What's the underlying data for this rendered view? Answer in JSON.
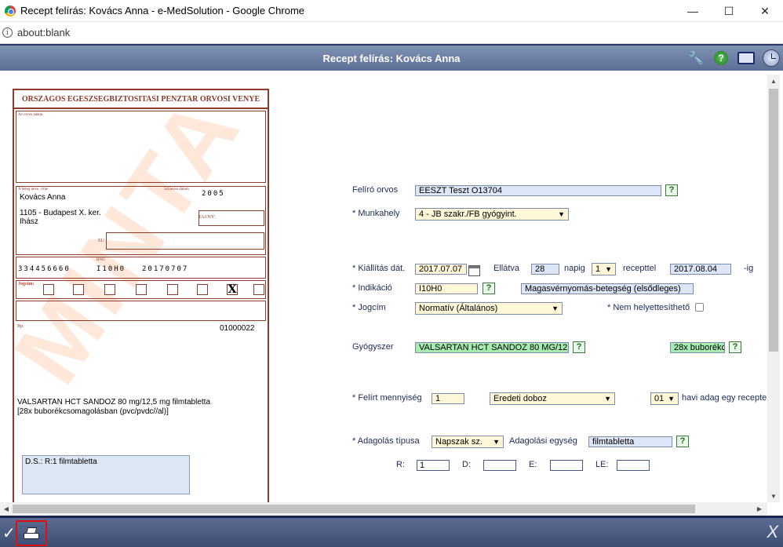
{
  "window": {
    "title": "Recept felírás: Kovács Anna - e-MedSolution - Google Chrome"
  },
  "address": {
    "url": "about:blank"
  },
  "app": {
    "title": "Recept felírás: Kovács Anna"
  },
  "prescription_form": {
    "header": "ORSZAGOS EGESZSEGBIZTOSITASI PENZTAR ORVOSI VENYE",
    "doctor_label": "Az orvos adatai",
    "patient_label": "A beteg neve, címe",
    "birth_label": "Születési dátum",
    "birth_year": "2005",
    "patient_name": "Kovács Anna",
    "patient_address_line1": "1105 - Budapest X. ker.",
    "patient_address_line2": "Ihász",
    "taj_label": "TAJ/NY:",
    "eu_label": "EU",
    "taj_number": "334456660",
    "bno_label": "BNO",
    "bno_code": "I10H0",
    "date_digits": "20170707",
    "jogcim_label": "Jogcím:",
    "x_mark": "X",
    "rx_number": "01000022",
    "rp_label": "Rp.",
    "drug_line1": "VALSARTAN HCT SANDOZ 80 mg/12,5 mg filmtabletta",
    "drug_line2": "[28x buborékcsomagolásban (pvc/pvdc//al)]",
    "ds_text": "D.S.: R:1 filmtabletta",
    "stamp": "MINTA"
  },
  "form": {
    "felíro_orvos_label": "Felíró orvos",
    "felíro_orvos_value": "EESZT Teszt O13704",
    "munkahely_label": "* Munkahely",
    "munkahely_value": "4 - JB szakr./FB gyógyint.",
    "kiallitas_label": "* Kiállítás dát.",
    "kiallitas_value": "2017.07.07",
    "ellatva_label": "Ellátva",
    "ellatva_value": "28",
    "napig_label": "napig",
    "recept_count": "1",
    "recepttel_label": "recepttel",
    "end_date": "2017.08.04",
    "ig_label": "-ig",
    "indikacio_label": "* Indikáció",
    "indikacio_code": "I10H0",
    "indikacio_text": "Magasvérnyomás-betegség (elsődleges)",
    "jogcim_label": "* Jogcím",
    "jogcim_value": "Normatív (Általános)",
    "nem_helyettesitheto_label": "* Nem helyettesíthető",
    "gyogyszer_label": "Gyógyszer",
    "gyogyszer_value": "VALSARTAN HCT SANDOZ 80 MG/12.",
    "kiszereles_value": "28x buborékc",
    "mennyiseg_label": "* Felírt mennyiség",
    "mennyiseg_value": "1",
    "doboz_value": "Eredeti doboz",
    "havi_value": "01",
    "havi_label": "havi adag egy recepten",
    "adagolas_tipus_label": "* Adagolás típusa",
    "adagolas_tipus_value": "Napszak sz.",
    "adagolasi_egyseg_label": "Adagolási egység",
    "adagolasi_egyseg_value": "filmtabletta",
    "r_label": "R:",
    "r_value": "1",
    "d_label": "D:",
    "e_label": "E:",
    "le_label": "LE:",
    "help": "?"
  },
  "icons": {
    "ok": "✓",
    "close": "X",
    "wrench": "🔧",
    "help": "?",
    "caret": "▼",
    "close_window": "✕",
    "maximize": "☐",
    "minimize": "—",
    "scroll_up": "▲",
    "scroll_down": "▼",
    "scroll_left": "◀",
    "scroll_right": "▶",
    "info": "i"
  }
}
